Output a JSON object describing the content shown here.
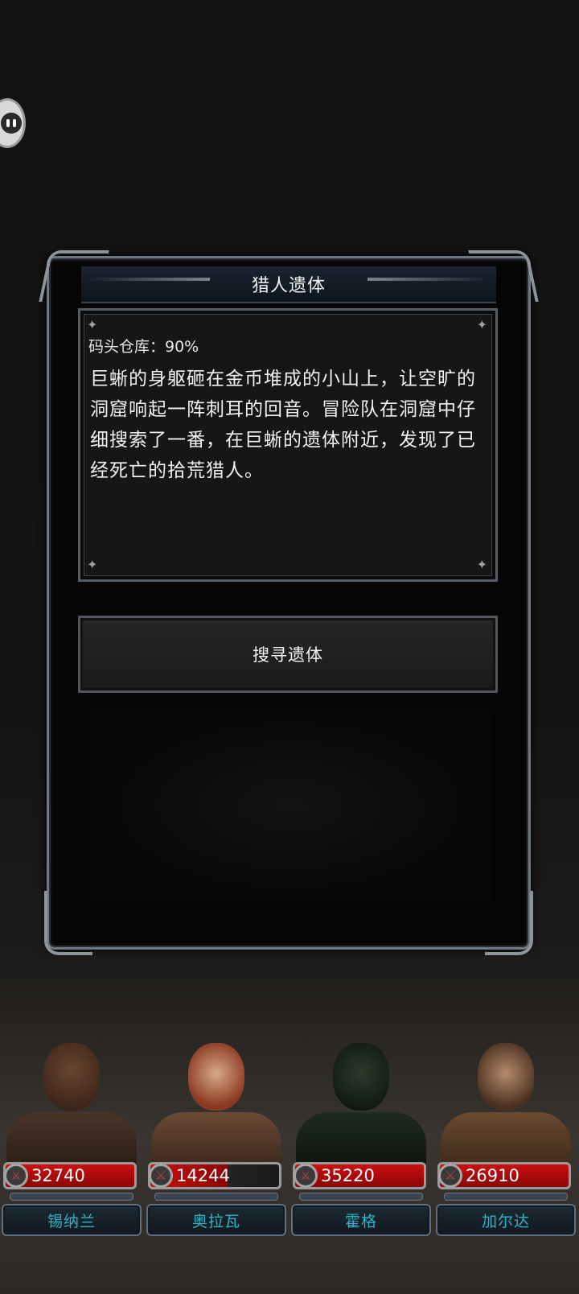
{
  "dialog": {
    "title": "猎人遗体",
    "location": "码头仓库：90%",
    "story": "巨蜥的身躯砸在金币堆成的小山上，让空旷的洞窟响起一阵刺耳的回音。冒险队在洞窟中仔细搜索了一番，在巨蜥的遗体附近，发现了已经死亡的拾荒猎人。",
    "action_label": "搜寻遗体"
  },
  "heroes": [
    {
      "name": "锡纳兰",
      "hp": "32740",
      "hp_fill": 1.0
    },
    {
      "name": "奥拉瓦",
      "hp": "14244",
      "hp_fill": 0.6
    },
    {
      "name": "霍格",
      "hp": "35220",
      "hp_fill": 1.0
    },
    {
      "name": "加尔达",
      "hp": "26910",
      "hp_fill": 1.0
    }
  ],
  "colors": {
    "hp_red": "#cc1010",
    "name_teal": "#2fb3c9",
    "frame_steel": "#6f7780"
  },
  "icons": [
    "chat-bubble-icon",
    "sword-icon",
    "sparkle-icon"
  ]
}
